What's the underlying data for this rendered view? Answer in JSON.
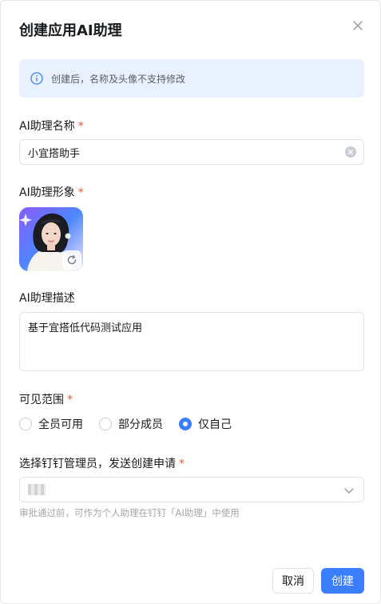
{
  "dialog": {
    "title": "创建应用AI助理",
    "notice": "创建后，名称及头像不支持修改",
    "name_field": {
      "label": "AI助理名称",
      "required_mark": "*",
      "value": "小宜搭助手"
    },
    "avatar_field": {
      "label": "AI助理形象",
      "required_mark": "*"
    },
    "description_field": {
      "label": "AI助理描述",
      "value": "基于宜搭低代码测试应用"
    },
    "visibility_field": {
      "label": "可见范围",
      "required_mark": "*",
      "options": [
        {
          "label": "全员可用",
          "checked": false
        },
        {
          "label": "部分成员",
          "checked": false
        },
        {
          "label": "仅自己",
          "checked": true
        }
      ]
    },
    "admin_field": {
      "label": "选择钉钉管理员，发送创建申请",
      "required_mark": "*",
      "hint": "审批通过前，可作为个人助理在钉钉「AI助理」中使用"
    },
    "buttons": {
      "cancel": "取消",
      "create": "创建"
    }
  },
  "colors": {
    "primary": "#3a7dff",
    "required": "#ff5219",
    "notice_bg": "#e8f1fd"
  },
  "icons": [
    "close-icon",
    "info-icon",
    "clear-icon",
    "refresh-icon",
    "chevron-down-icon"
  ]
}
